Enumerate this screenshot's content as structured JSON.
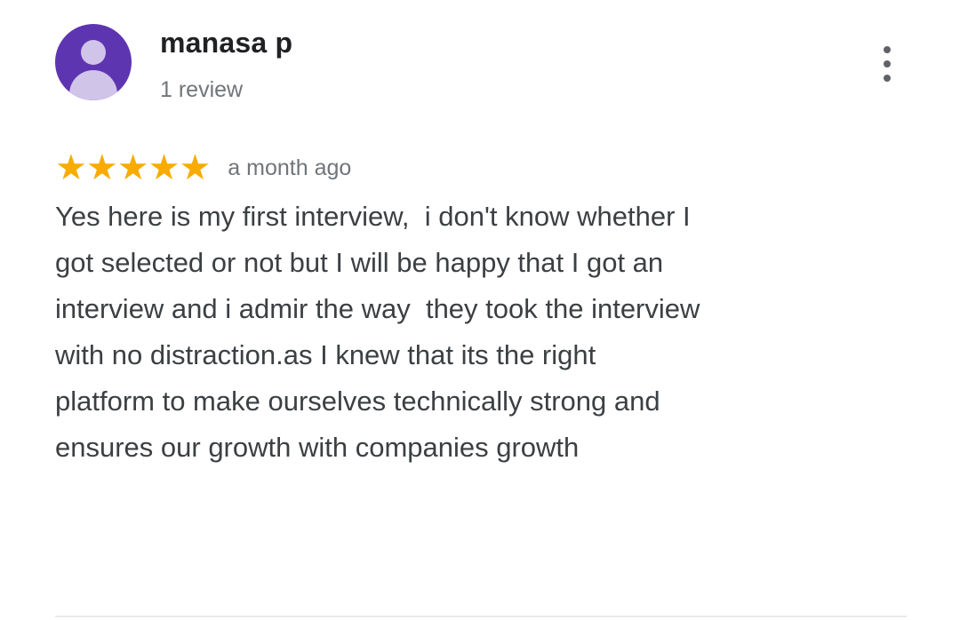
{
  "review": {
    "reviewer_name": "manasa p",
    "review_count": "1 review",
    "avatar_color": "#5e35b1",
    "rating": 5,
    "rating_max": 5,
    "star_color": "#f9ab00",
    "date": "a month ago",
    "text": "Yes here is my first interview,  i don't know whether I\ngot selected or not but I will be happy that I got an\ninterview and i admir the way  they took the interview\nwith no distraction.as I knew that its the right\nplatform to make ourselves technically strong and\nensures our growth with companies growth",
    "more_icon": "more-vert-icon",
    "avatar_icon": "person-icon"
  }
}
